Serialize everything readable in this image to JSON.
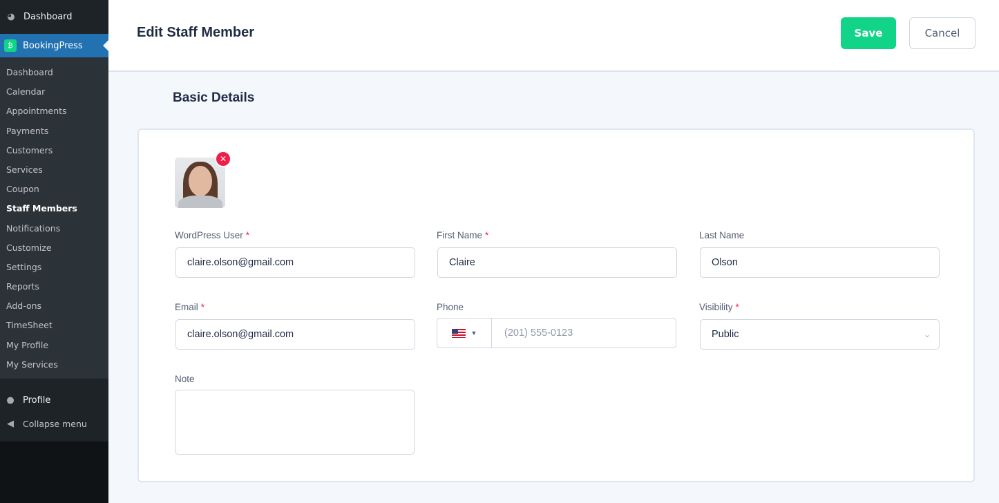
{
  "sidebar": {
    "dashboard": "Dashboard",
    "plugin": "BookingPress",
    "items": [
      "Dashboard",
      "Calendar",
      "Appointments",
      "Payments",
      "Customers",
      "Services",
      "Coupon",
      "Staff Members",
      "Notifications",
      "Customize",
      "Settings",
      "Reports",
      "Add-ons",
      "TimeSheet",
      "My Profile",
      "My Services"
    ],
    "current": "Staff Members",
    "profile": "Profile",
    "collapse": "Collapse menu"
  },
  "header": {
    "title": "Edit Staff Member",
    "save": "Save",
    "cancel": "Cancel"
  },
  "section": "Basic Details",
  "form": {
    "wp_user": {
      "label": "WordPress User",
      "value": "claire.olson@gmail.com"
    },
    "first_name": {
      "label": "First Name",
      "value": "Claire"
    },
    "last_name": {
      "label": "Last Name",
      "value": "Olson"
    },
    "email": {
      "label": "Email",
      "value": "claire.olson@gmail.com"
    },
    "phone": {
      "label": "Phone",
      "placeholder": "(201) 555-0123",
      "country": "US"
    },
    "visibility": {
      "label": "Visibility",
      "value": "Public"
    },
    "note": {
      "label": "Note",
      "value": ""
    },
    "required_mark": "*"
  },
  "colors": {
    "accent": "#12d488",
    "danger": "#f01f4a",
    "wp_blue": "#2271b1"
  }
}
